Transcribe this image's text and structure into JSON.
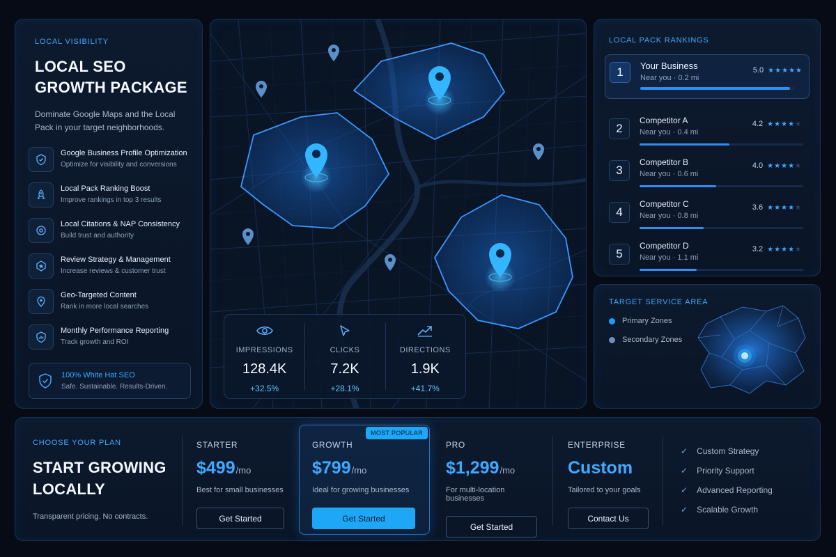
{
  "left": {
    "eyebrow": "LOCAL VISIBILITY",
    "title_line1": "LOCAL SEO",
    "title_line2": "GROWTH PACKAGE",
    "subtitle_line1": "Dominate Google Maps and the Local",
    "subtitle_line2": "Pack in your target neighborhoods.",
    "features": [
      {
        "title": "Google Business Profile Optimization",
        "desc": "Optimize for visibility and conversions",
        "icon": "shield-badge-icon"
      },
      {
        "title": "Local Pack Ranking Boost",
        "desc": "Improve rankings in top 3 results",
        "icon": "rocket-icon"
      },
      {
        "title": "Local Citations & NAP Consistency",
        "desc": "Build trust and authority",
        "icon": "location-pin-icon"
      },
      {
        "title": "Review Strategy & Management",
        "desc": "Increase reviews & customer trust",
        "icon": "star-badge-icon"
      },
      {
        "title": "Geo-Targeted Content",
        "desc": "Rank in more local searches",
        "icon": "map-pin-icon"
      },
      {
        "title": "Monthly Performance Reporting",
        "desc": "Track growth and ROI",
        "icon": "chart-report-icon"
      }
    ],
    "whitehat": {
      "title": "100% White Hat SEO",
      "desc": "Safe. Sustainable. Results-Driven."
    }
  },
  "stats": [
    {
      "label": "IMPRESSIONS",
      "value": "128.4K",
      "delta": "+32.5%",
      "icon": "eye-icon"
    },
    {
      "label": "CLICKS",
      "value": "7.2K",
      "delta": "+28.1%",
      "icon": "cursor-icon"
    },
    {
      "label": "DIRECTIONS",
      "value": "1.9K",
      "delta": "+41.7%",
      "icon": "trend-arrow-icon"
    }
  ],
  "rankings": {
    "eyebrow": "LOCAL PACK RANKINGS",
    "rows": [
      {
        "rank": "1",
        "name": "Your Business",
        "dist": "Near you · 0.2 mi",
        "score": "5.0",
        "stars": 5,
        "fill": 0.97
      },
      {
        "rank": "2",
        "name": "Competitor A",
        "dist": "Near you · 0.4 mi",
        "score": "4.2",
        "stars": 4,
        "fill": 0.55
      },
      {
        "rank": "3",
        "name": "Competitor B",
        "dist": "Near you · 0.6 mi",
        "score": "4.0",
        "stars": 4,
        "fill": 0.47
      },
      {
        "rank": "4",
        "name": "Competitor C",
        "dist": "Near you · 0.8 mi",
        "score": "3.6",
        "stars": 4,
        "fill": 0.39
      },
      {
        "rank": "5",
        "name": "Competitor D",
        "dist": "Near you · 1.1 mi",
        "score": "3.2",
        "stars": 4,
        "fill": 0.35
      }
    ]
  },
  "area": {
    "eyebrow": "TARGET SERVICE AREA",
    "primary": "Primary Zones",
    "secondary": "Secondary Zones",
    "primary_color": "#1e9bff",
    "secondary_color": "#6f8fbf"
  },
  "pricing": {
    "eyebrow": "CHOOSE YOUR PLAN",
    "title_line1": "START GROWING",
    "title_line2": "LOCALLY",
    "note": "Transparent pricing. No contracts.",
    "badge": "MOST POPULAR",
    "plans": [
      {
        "name": "STARTER",
        "price": "$499",
        "per": "/mo",
        "desc": "Best for small businesses",
        "cta": "Get Started"
      },
      {
        "name": "GROWTH",
        "price": "$799",
        "per": "/mo",
        "desc": "Ideal for growing businesses",
        "cta": "Get Started"
      },
      {
        "name": "PRO",
        "price": "$1,299",
        "per": "/mo",
        "desc": "For multi-location businesses",
        "cta": "Get Started"
      },
      {
        "name": "ENTERPRISE",
        "price": "Custom",
        "per": "",
        "desc": "Tailored to your goals",
        "cta": "Contact Us"
      }
    ],
    "checklist": [
      "Custom Strategy",
      "Priority Support",
      "Advanced Reporting",
      "Scalable Growth"
    ]
  },
  "colors": {
    "accent": "#3fa8ff",
    "cta": "#1ea7f7",
    "panel_bg": "#0b1728"
  }
}
